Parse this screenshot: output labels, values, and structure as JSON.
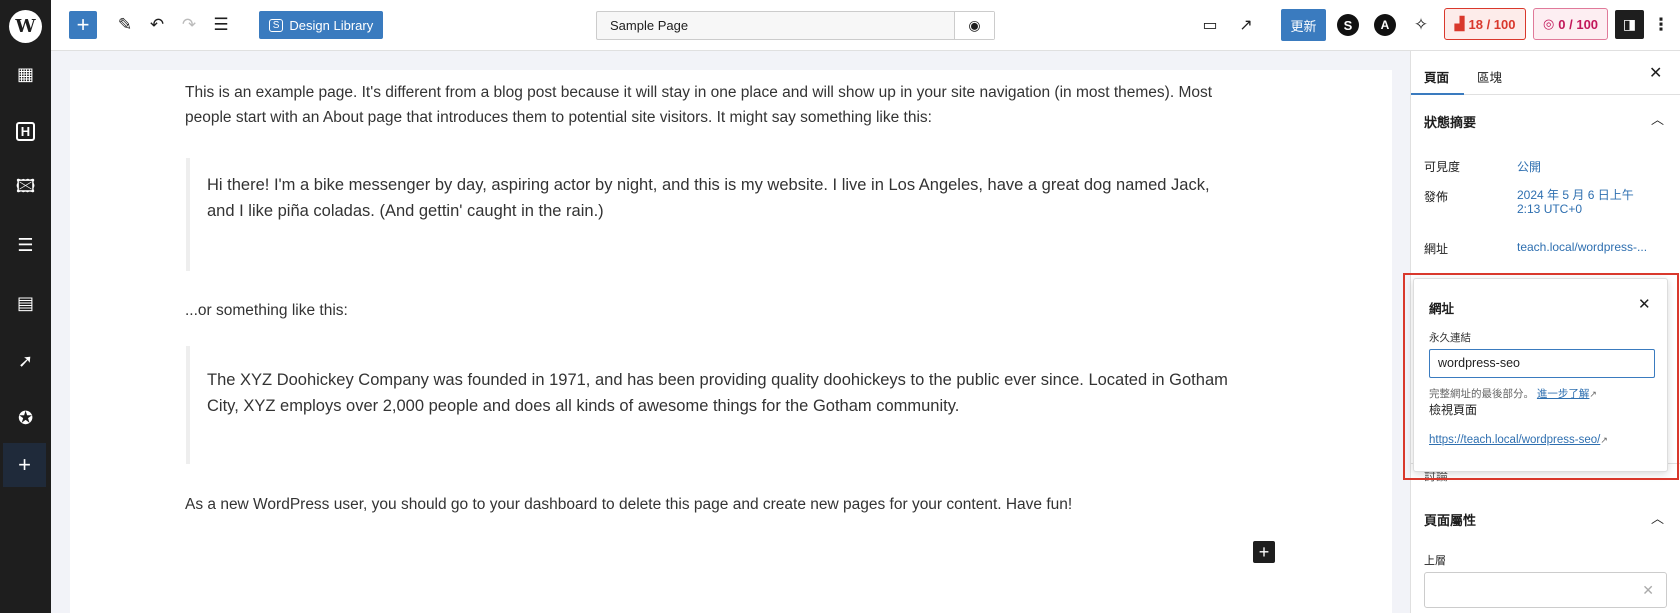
{
  "toolbar": {
    "design_library": "Design Library",
    "page_title": "Sample Page",
    "update": "更新",
    "score1": "18 / 100",
    "score2": "0 / 100",
    "colors": {
      "accent": "#3a7bbf",
      "score1": "#d9382c",
      "score2": "#c2185b"
    }
  },
  "left_sidebar": {
    "icons": [
      "wordpress-logo",
      "patterns-icon",
      "heading-icon",
      "image-icon",
      "sections-icon",
      "form-icon",
      "cursor-click-icon",
      "star-badge-icon",
      "plus-icon"
    ]
  },
  "content": {
    "p1": "This is an example page. It's different from a blog post because it will stay in one place and will show up in your site navigation (in most themes). Most people start with an About page that introduces them to potential site visitors. It might say something like this:",
    "q1": "Hi there! I'm a bike messenger by day, aspiring actor by night, and this is my website. I live in Los Angeles, have a great dog named Jack, and I like piña coladas. (And gettin' caught in the rain.)",
    "p2": "...or something like this:",
    "q2": "The XYZ Doohickey Company was founded in 1971, and has been providing quality doohickeys to the public ever since. Located in Gotham City, XYZ employs over 2,000 people and does all kinds of awesome things for the Gotham community.",
    "p3": "As a new WordPress user, you should go to your dashboard to delete this page and create new pages for your content. Have fun!"
  },
  "panel": {
    "tabs": [
      "頁面",
      "區塊"
    ],
    "summary_title": "狀態摘要",
    "visibility_label": "可見度",
    "visibility_value": "公開",
    "publish_label": "發佈",
    "publish_value": "2024 年 5 月 6 日上午 2:13 UTC+0",
    "url_label": "網址",
    "url_value": "teach.local/wordpress-...",
    "discussion": "討論",
    "attributes_title": "頁面屬性",
    "parent_label": "上層"
  },
  "popover": {
    "title": "網址",
    "permalink_label": "永久連結",
    "permalink_value": "wordpress-seo",
    "help": "完整網址的最後部分。",
    "learn_more": "進一步了解",
    "view_page": "檢視頁面",
    "full_url": "https://teach.local/wordpress-seo/"
  }
}
